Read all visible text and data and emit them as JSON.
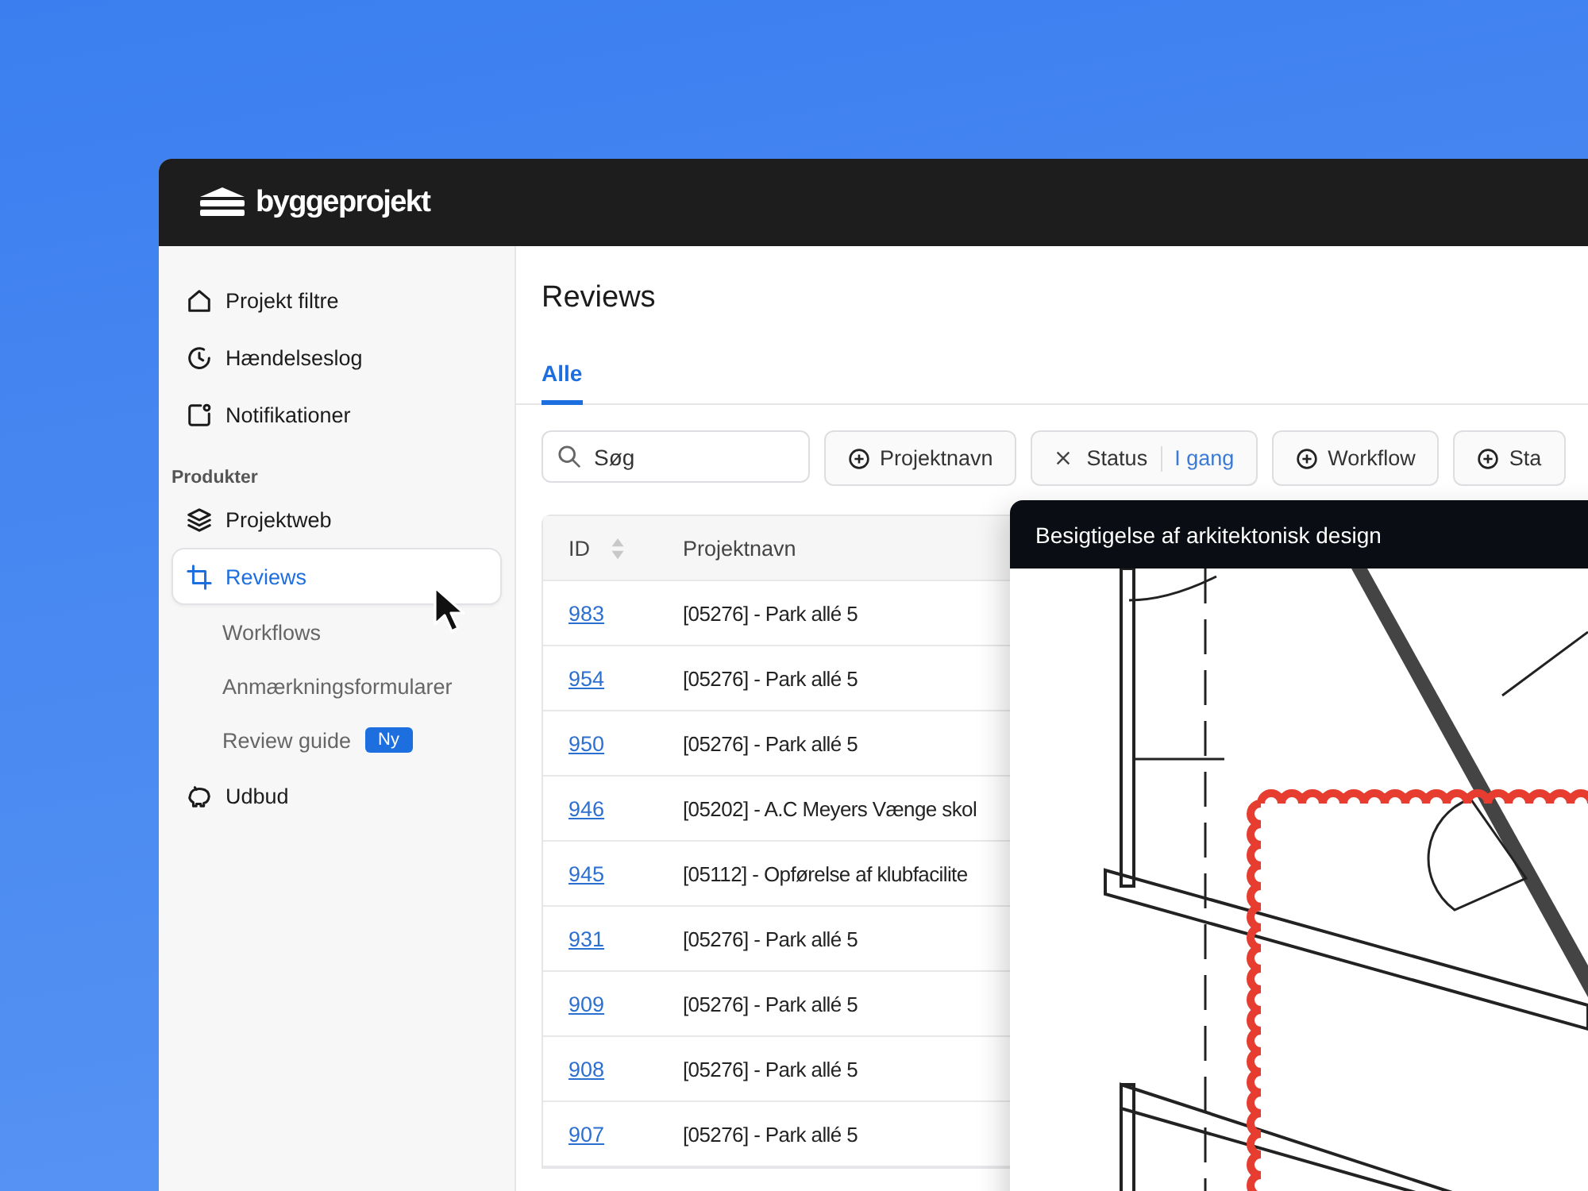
{
  "brand": {
    "name": "byggeprojekt"
  },
  "sidebar": {
    "items": [
      {
        "label": "Projekt filtre",
        "selected": false
      },
      {
        "label": "Hændelseslog",
        "selected": false
      },
      {
        "label": "Notifikationer",
        "selected": false
      }
    ],
    "sections": [
      {
        "label": "Produkter",
        "items": [
          {
            "label": "Projektweb",
            "selected": false
          },
          {
            "label": "Reviews",
            "selected": true,
            "children": [
              {
                "label": "Workflows",
                "selected": false
              },
              {
                "label": "Anmærkningsformularer",
                "selected": false
              },
              {
                "label": "Review guide",
                "selected": false,
                "badge": "Ny"
              }
            ]
          },
          {
            "label": "Udbud",
            "selected": false
          }
        ]
      }
    ]
  },
  "page": {
    "title": "Reviews"
  },
  "tabs": [
    {
      "label": "Alle",
      "selected": true
    }
  ],
  "search": {
    "placeholder": "Søg"
  },
  "filters": [
    {
      "kind": "add",
      "label": "Projektnavn"
    },
    {
      "kind": "active",
      "label": "Status",
      "value": "I gang"
    },
    {
      "kind": "add",
      "label": "Workflow"
    },
    {
      "kind": "add",
      "label": "Sta"
    }
  ],
  "table": {
    "columns": [
      "ID",
      "Projektnavn"
    ],
    "rows": [
      {
        "id": "983",
        "name": "[05276] - Park allé 5"
      },
      {
        "id": "954",
        "name": "[05276] - Park allé 5"
      },
      {
        "id": "950",
        "name": "[05276] - Park allé 5"
      },
      {
        "id": "946",
        "name": "[05202] - A.C Meyers Vænge skol"
      },
      {
        "id": "945",
        "name": "[05112] - Opførelse af klubfacilite"
      },
      {
        "id": "931",
        "name": "[05276] - Park allé 5"
      },
      {
        "id": "909",
        "name": "[05276] - Park allé 5"
      },
      {
        "id": "908",
        "name": "[05276] - Park allé 5"
      },
      {
        "id": "907",
        "name": "[05276] - Park allé 5"
      }
    ]
  },
  "preview": {
    "title": "Besigtigelse af arkitektonisk design"
  }
}
